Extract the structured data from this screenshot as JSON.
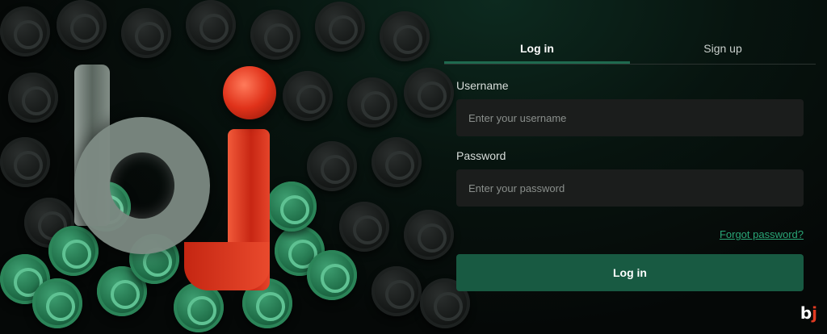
{
  "tabs": [
    {
      "label": "Log in",
      "active": true
    },
    {
      "label": "Sign up",
      "active": false
    }
  ],
  "form": {
    "username_label": "Username",
    "username_placeholder": "Enter your username",
    "password_label": "Password",
    "password_placeholder": "Enter your password",
    "forgot_label": "Forgot password?",
    "submit_label": "Log in"
  },
  "logo": {
    "b": "b",
    "j": "j"
  },
  "colors": {
    "accent": "#185a42",
    "link": "#2aa677",
    "logo_red": "#e23a22",
    "background": "#050807"
  },
  "icons": [
    "bj-logo-icon"
  ]
}
